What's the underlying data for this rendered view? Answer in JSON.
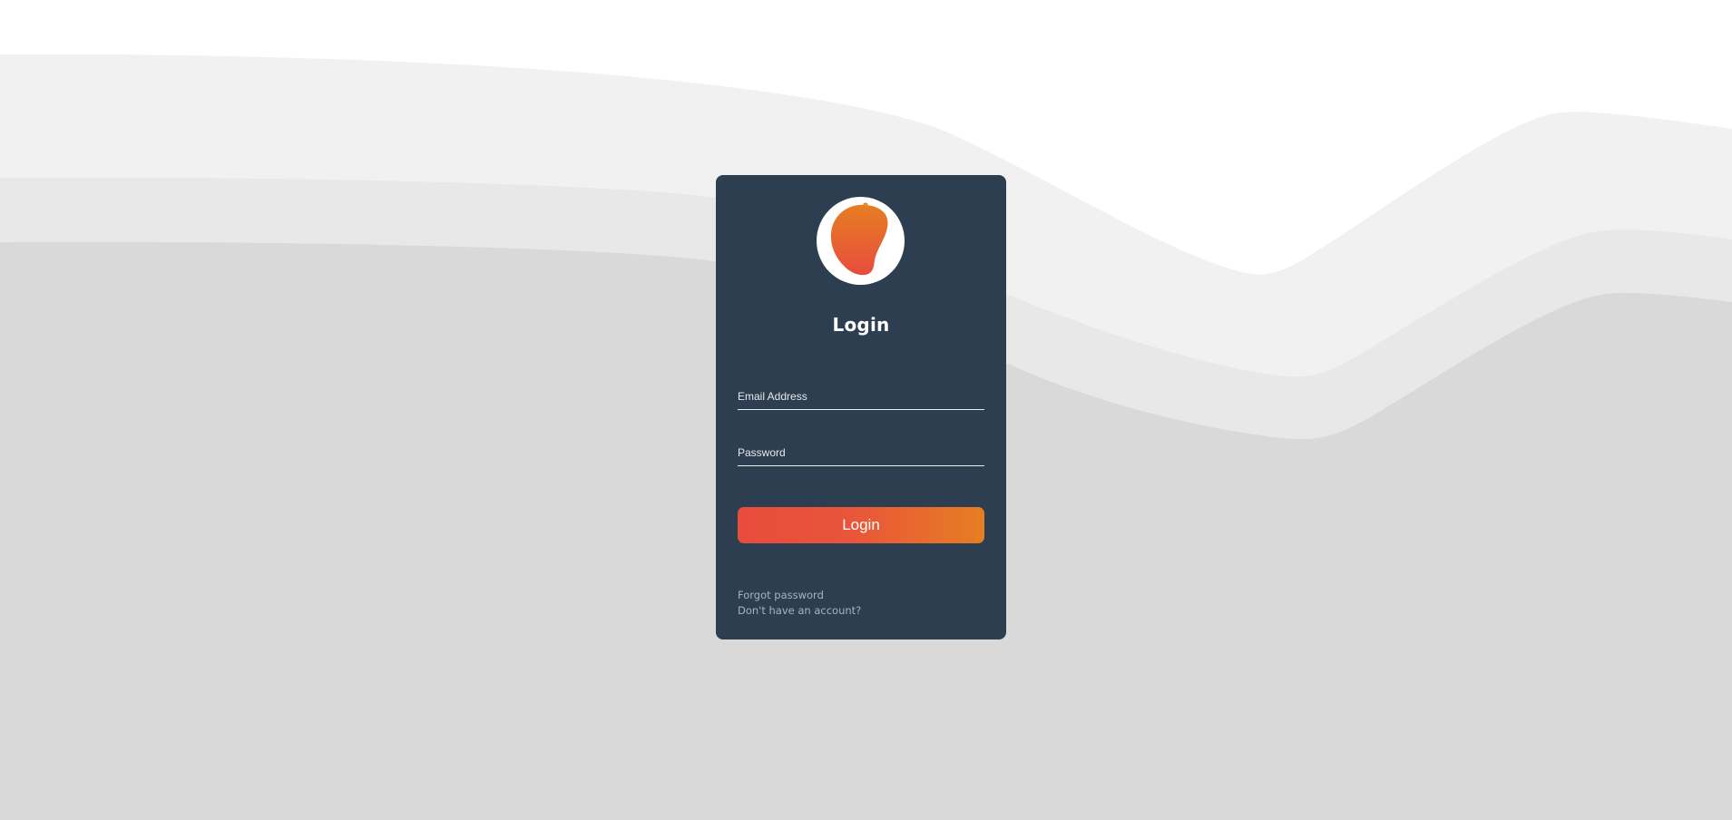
{
  "login": {
    "title": "Login",
    "email_placeholder": "Email Address",
    "password_placeholder": "Password",
    "submit_label": "Login",
    "forgot_password": "Forgot password",
    "signup_prompt": "Don't have an account?"
  },
  "colors": {
    "card_background": "#2d3e50",
    "accent_start": "#e84c3d",
    "accent_end": "#e67e22",
    "page_background": "#ffffff",
    "wave_light": "#f1f1f1",
    "wave_mid": "#e8e8e8",
    "wave_dark": "#d9d9d9",
    "link_text": "#a9b4bf"
  },
  "icons": {
    "logo": "mango-logo-icon"
  }
}
